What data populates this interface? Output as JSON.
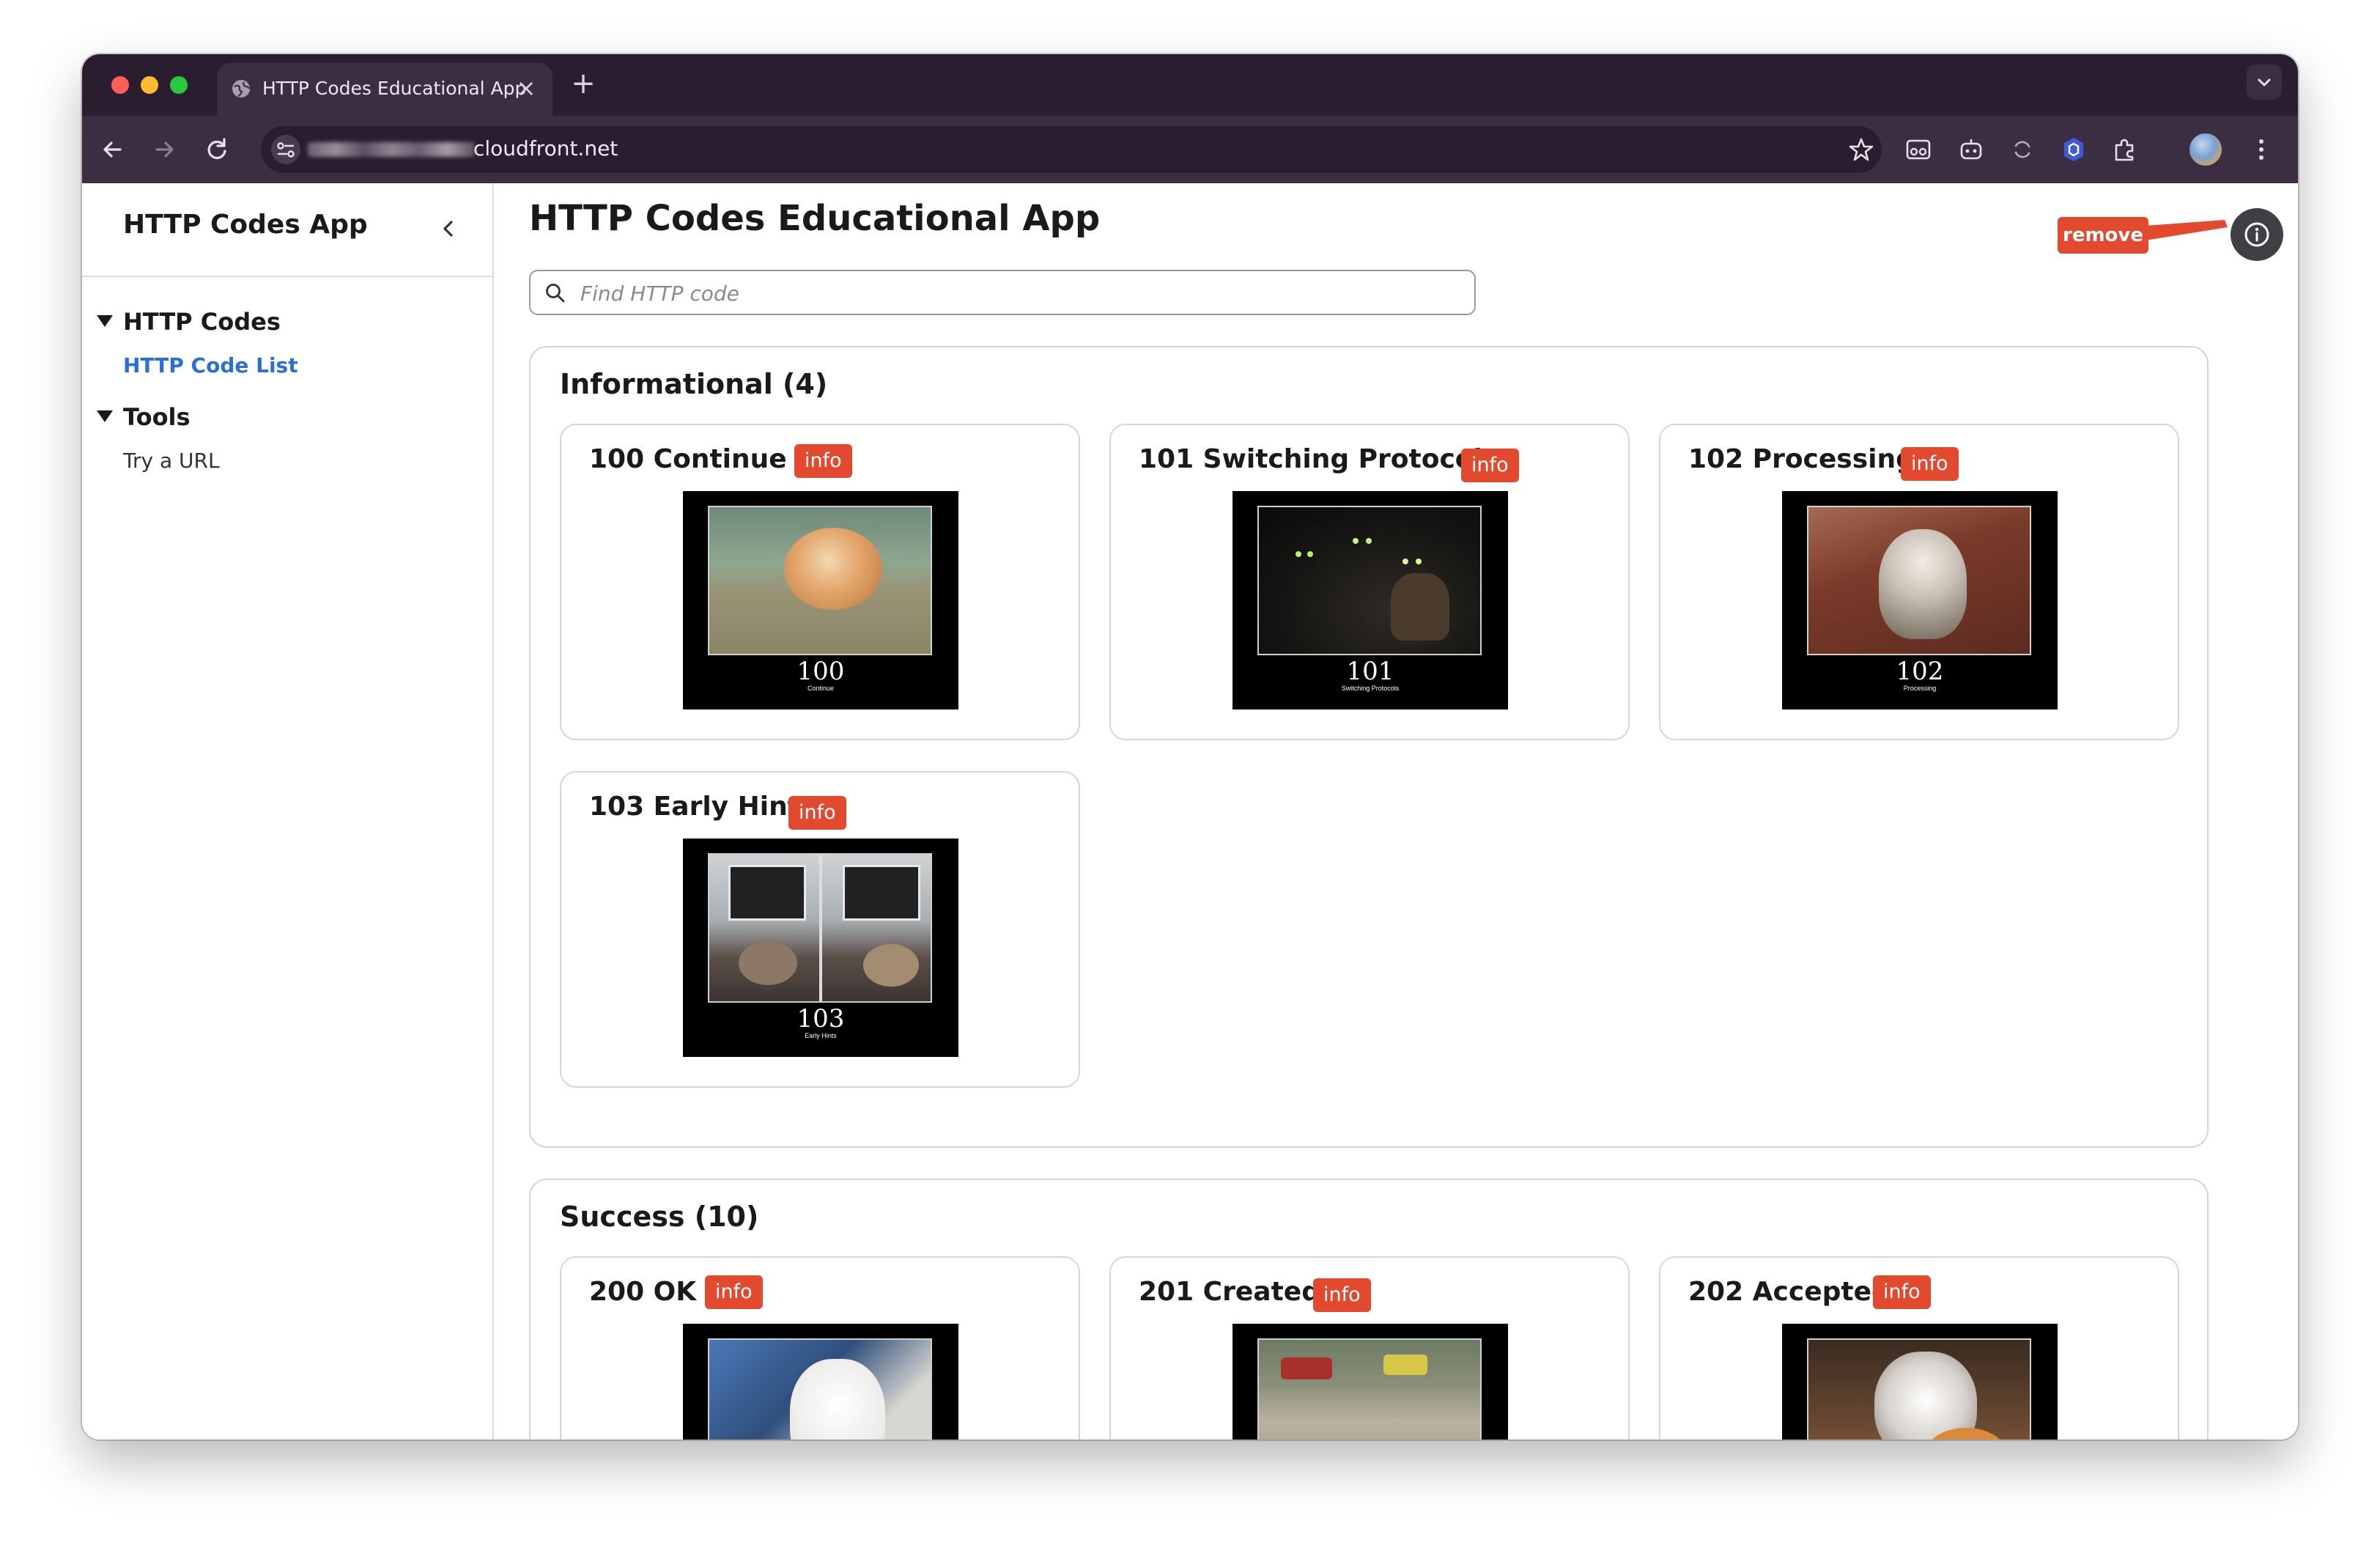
{
  "browser": {
    "tab_title": "HTTP Codes Educational App",
    "url": "cloudfront.net",
    "colors": {
      "frame": "#2a1d30",
      "toolbar": "#3c2d42"
    }
  },
  "sidebar": {
    "title": "HTTP Codes App",
    "groups": [
      {
        "label": "HTTP Codes",
        "items": [
          {
            "label": "HTTP Code List",
            "active": true
          }
        ]
      },
      {
        "label": "Tools",
        "items": [
          {
            "label": "Try a URL",
            "active": false
          }
        ]
      }
    ]
  },
  "main": {
    "title": "HTTP Codes Educational App",
    "search_placeholder": "Find HTTP code",
    "remove_label": "remove",
    "accent": "#e2492f",
    "link_color": "#2a6fd6",
    "sections": [
      {
        "title": "Informational (4)",
        "cards": [
          {
            "title": "100 Continue",
            "badge": "info",
            "number": "100",
            "caption": "Continue"
          },
          {
            "title": "101 Switching Protocols",
            "badge": "info",
            "number": "101",
            "caption": "Switching Protocols"
          },
          {
            "title": "102 Processing",
            "badge": "info",
            "number": "102",
            "caption": "Processing"
          },
          {
            "title": "103 Early Hints",
            "badge": "info",
            "number": "103",
            "caption": "Early Hints"
          }
        ]
      },
      {
        "title": "Success (10)",
        "cards": [
          {
            "title": "200 OK",
            "badge": "info"
          },
          {
            "title": "201 Created",
            "badge": "info"
          },
          {
            "title": "202 Accepted",
            "badge": "info"
          }
        ]
      }
    ]
  }
}
